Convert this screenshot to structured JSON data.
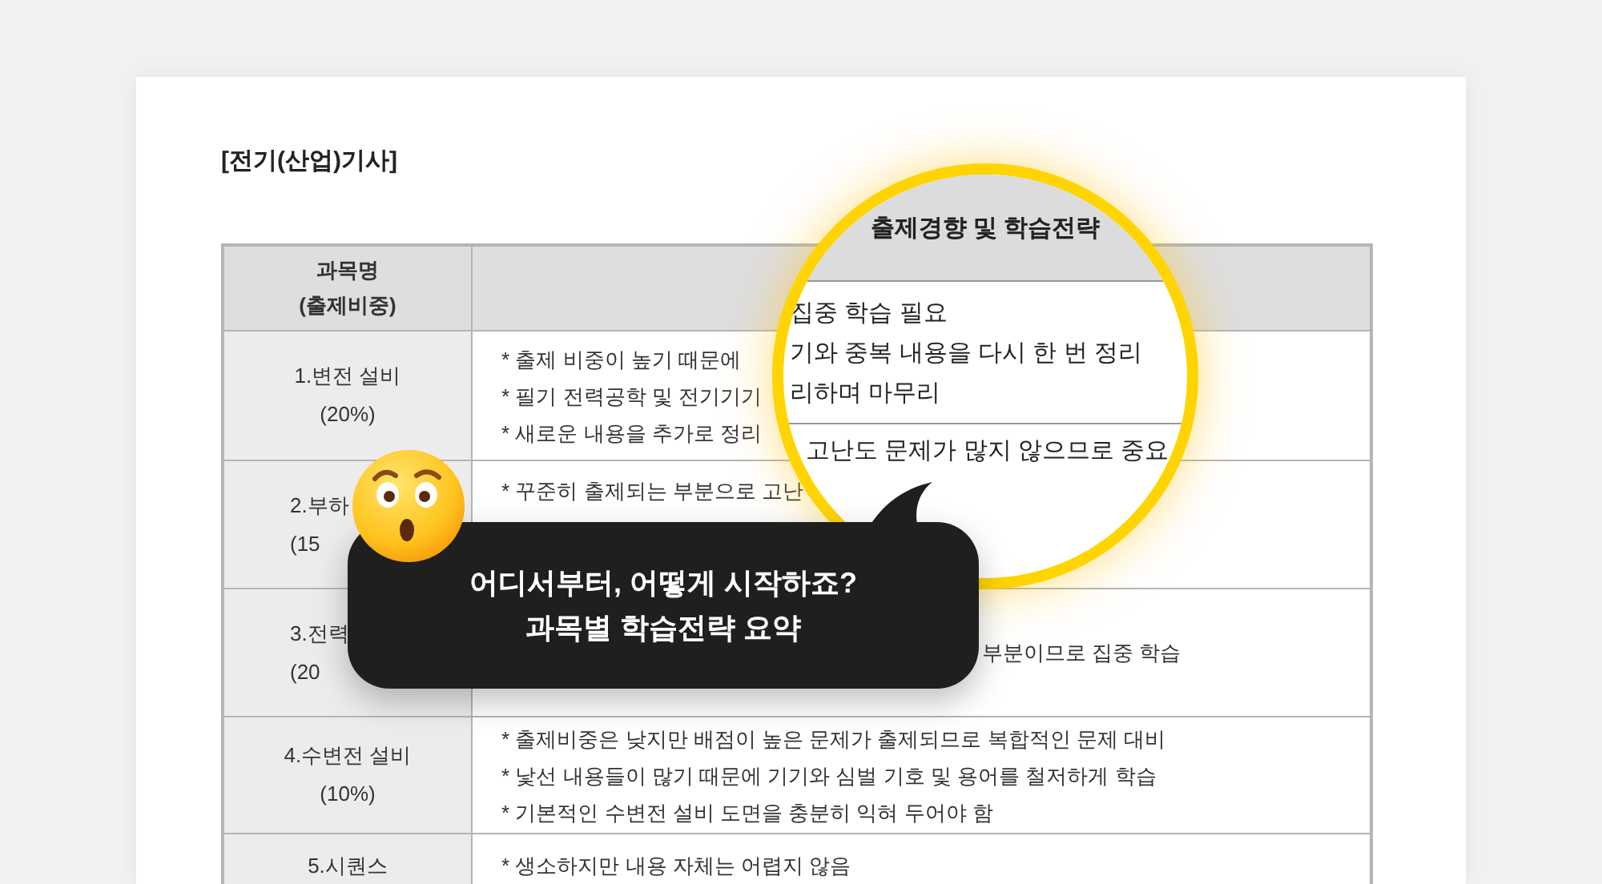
{
  "title": "[전기(산업)기사]",
  "table": {
    "columns": [
      {
        "label": "과목명\n(출제비중)"
      }
    ],
    "rows": [
      {
        "subject": "1.변전 설비\n(20%)",
        "notes": [
          "* 출제 비중이 높기 때문에",
          "* 필기 전력공학 및 전기기기",
          "* 새로운 내용을 추가로 정리"
        ]
      },
      {
        "subject": "2.부하\n(15",
        "notes": [
          "* 꾸준히 출제되는 부분으로 고난"
        ]
      },
      {
        "subject": "3.전력\n(20",
        "notes": [
          "부분이므로 집중 학습"
        ]
      },
      {
        "subject": "4.수변전 설비\n(10%)",
        "notes": [
          "* 출제비중은 낮지만 배점이 높은 문제가 출제되므로 복합적인 문제 대비",
          "* 낯선 내용들이 많기 때문에 기기와 심벌 기호 및 용어를 철저하게 학습",
          "* 기본적인 수변전 설비 도면을 충분히 익혀 두어야 함"
        ]
      },
      {
        "subject": "5.시퀀스",
        "notes": [
          "* 생소하지만 내용 자체는 어렵지 않음"
        ]
      }
    ]
  },
  "magnifier": {
    "header": "출제경향 및 학습전략",
    "lines": [
      "집중 학습 필요",
      "기와 중복 내용을 다시 한 번 정리",
      "리하며 마무리"
    ],
    "lines_below": [
      "고난도 문제가 많지 않으므로 중요"
    ]
  },
  "bubble": {
    "lines": [
      "어디서부터, 어떻게 시작하죠?",
      "과목별 학습전략 요약"
    ]
  }
}
